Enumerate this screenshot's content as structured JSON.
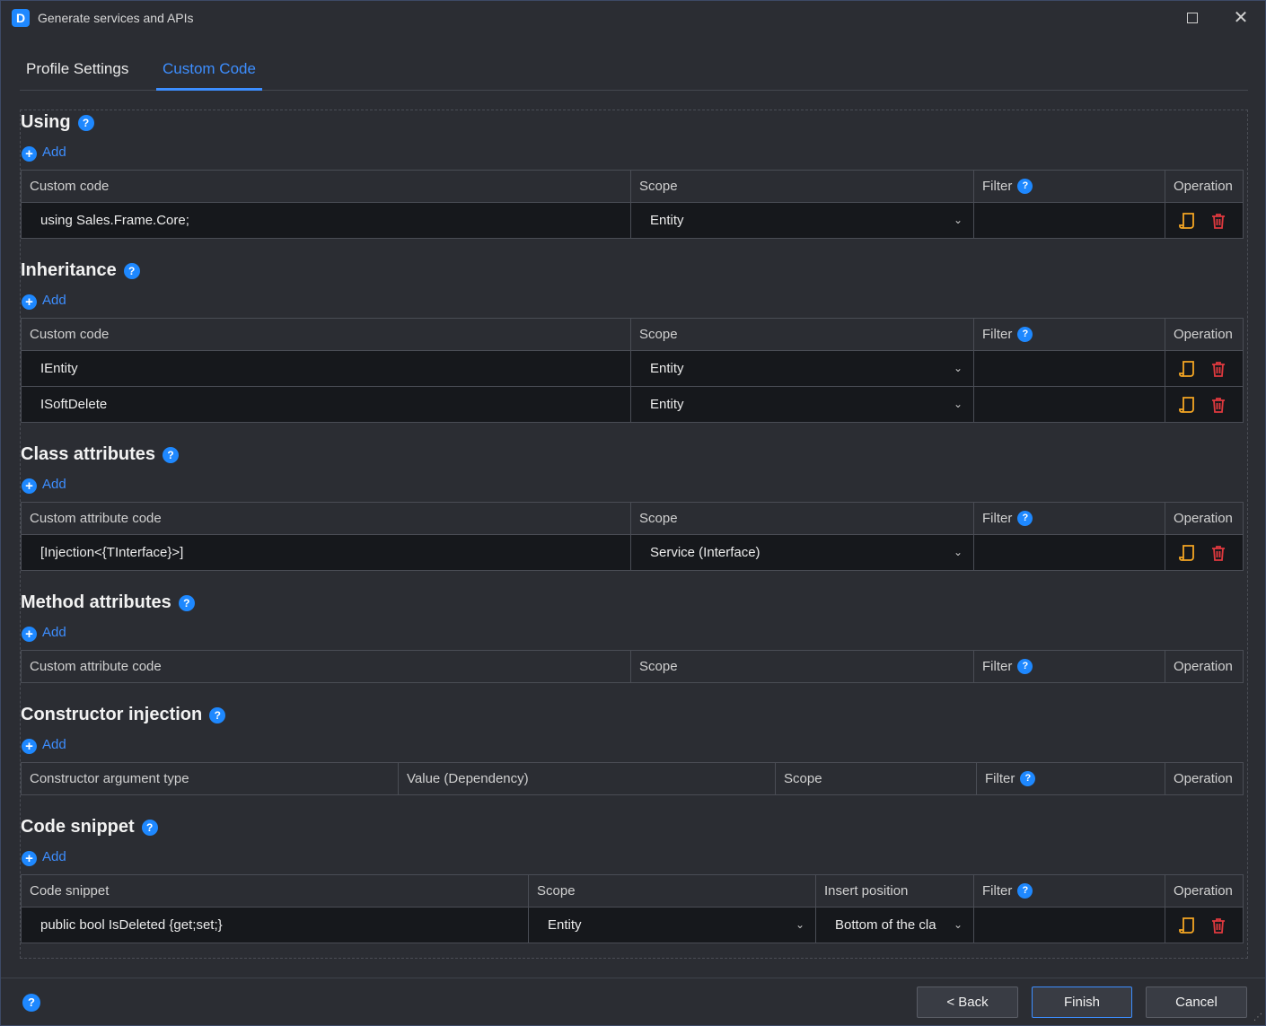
{
  "window": {
    "title": "Generate services and APIs",
    "app_icon": "D"
  },
  "tabs": [
    {
      "label": "Profile Settings",
      "active": false
    },
    {
      "label": "Custom Code",
      "active": true
    }
  ],
  "add_label": "Add",
  "help_glyph": "?",
  "sections": {
    "using": {
      "title": "Using",
      "headers": [
        "Custom code",
        "Scope",
        "Filter",
        "Operation"
      ],
      "rows": [
        {
          "code": "using Sales.Frame.Core;",
          "scope": "Entity",
          "filter": ""
        }
      ]
    },
    "inheritance": {
      "title": "Inheritance",
      "headers": [
        "Custom code",
        "Scope",
        "Filter",
        "Operation"
      ],
      "rows": [
        {
          "code": "IEntity",
          "scope": "Entity",
          "filter": ""
        },
        {
          "code": "ISoftDelete",
          "scope": "Entity",
          "filter": ""
        }
      ]
    },
    "class_attributes": {
      "title": "Class attributes",
      "headers": [
        "Custom attribute code",
        "Scope",
        "Filter",
        "Operation"
      ],
      "rows": [
        {
          "code": "[Injection<{TInterface}>]",
          "scope": "Service (Interface)",
          "filter": ""
        }
      ]
    },
    "method_attributes": {
      "title": "Method attributes",
      "headers": [
        "Custom attribute code",
        "Scope",
        "Filter",
        "Operation"
      ],
      "rows": []
    },
    "constructor_injection": {
      "title": "Constructor injection",
      "headers": [
        "Constructor argument type",
        "Value (Dependency)",
        "Scope",
        "Filter",
        "Operation"
      ],
      "rows": []
    },
    "code_snippet": {
      "title": "Code snippet",
      "headers": [
        "Code snippet",
        "Scope",
        "Insert position",
        "Filter",
        "Operation"
      ],
      "rows": [
        {
          "code": "public bool IsDeleted {get;set;}",
          "scope": "Entity",
          "insert_position": "Bottom of the cla",
          "filter": ""
        }
      ]
    }
  },
  "footer": {
    "back": "< Back",
    "finish": "Finish",
    "cancel": "Cancel"
  },
  "colors": {
    "accent": "#3d8eff",
    "edit_icon": "#f5a623",
    "delete_icon": "#e0393e",
    "cell_bg": "#16181c",
    "window_bg": "#2b2d33"
  }
}
